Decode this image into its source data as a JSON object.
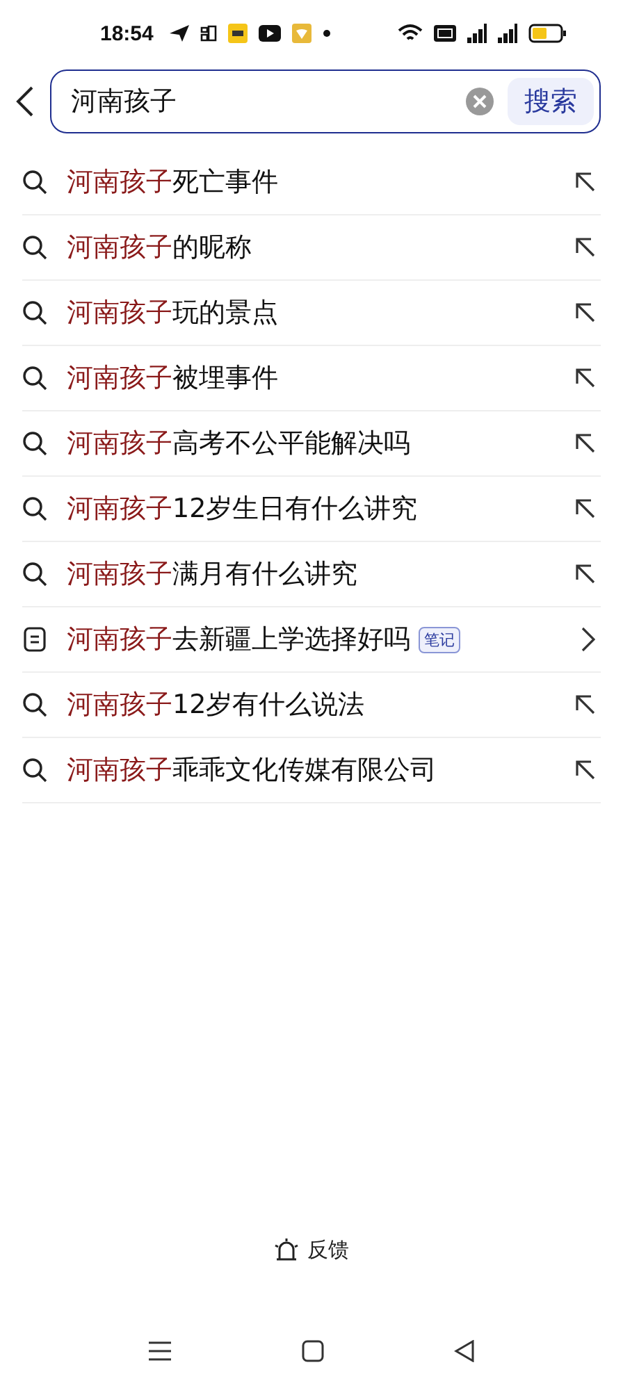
{
  "status_bar": {
    "time": "18:54"
  },
  "search": {
    "value": "河南孩子",
    "button": "搜索"
  },
  "suggestions": [
    {
      "kind": "query",
      "match": "河南孩子",
      "rest": "死亡事件"
    },
    {
      "kind": "query",
      "match": "河南孩子",
      "rest": "的昵称"
    },
    {
      "kind": "query",
      "match": "河南孩子",
      "rest": "玩的景点"
    },
    {
      "kind": "query",
      "match": "河南孩子",
      "rest": "被埋事件"
    },
    {
      "kind": "query",
      "match": "河南孩子",
      "rest": "高考不公平能解决吗"
    },
    {
      "kind": "query",
      "match": "河南孩子",
      "rest": "12岁生日有什么讲究"
    },
    {
      "kind": "query",
      "match": "河南孩子",
      "rest": "满月有什么讲究"
    },
    {
      "kind": "note",
      "match": "河南孩子",
      "rest": "去新疆上学选择好吗",
      "tag": "笔记"
    },
    {
      "kind": "query",
      "match": "河南孩子",
      "rest": "12岁有什么说法"
    },
    {
      "kind": "query",
      "match": "河南孩子",
      "rest": "乖乖文化传媒有限公司"
    }
  ],
  "feedback": "反馈"
}
